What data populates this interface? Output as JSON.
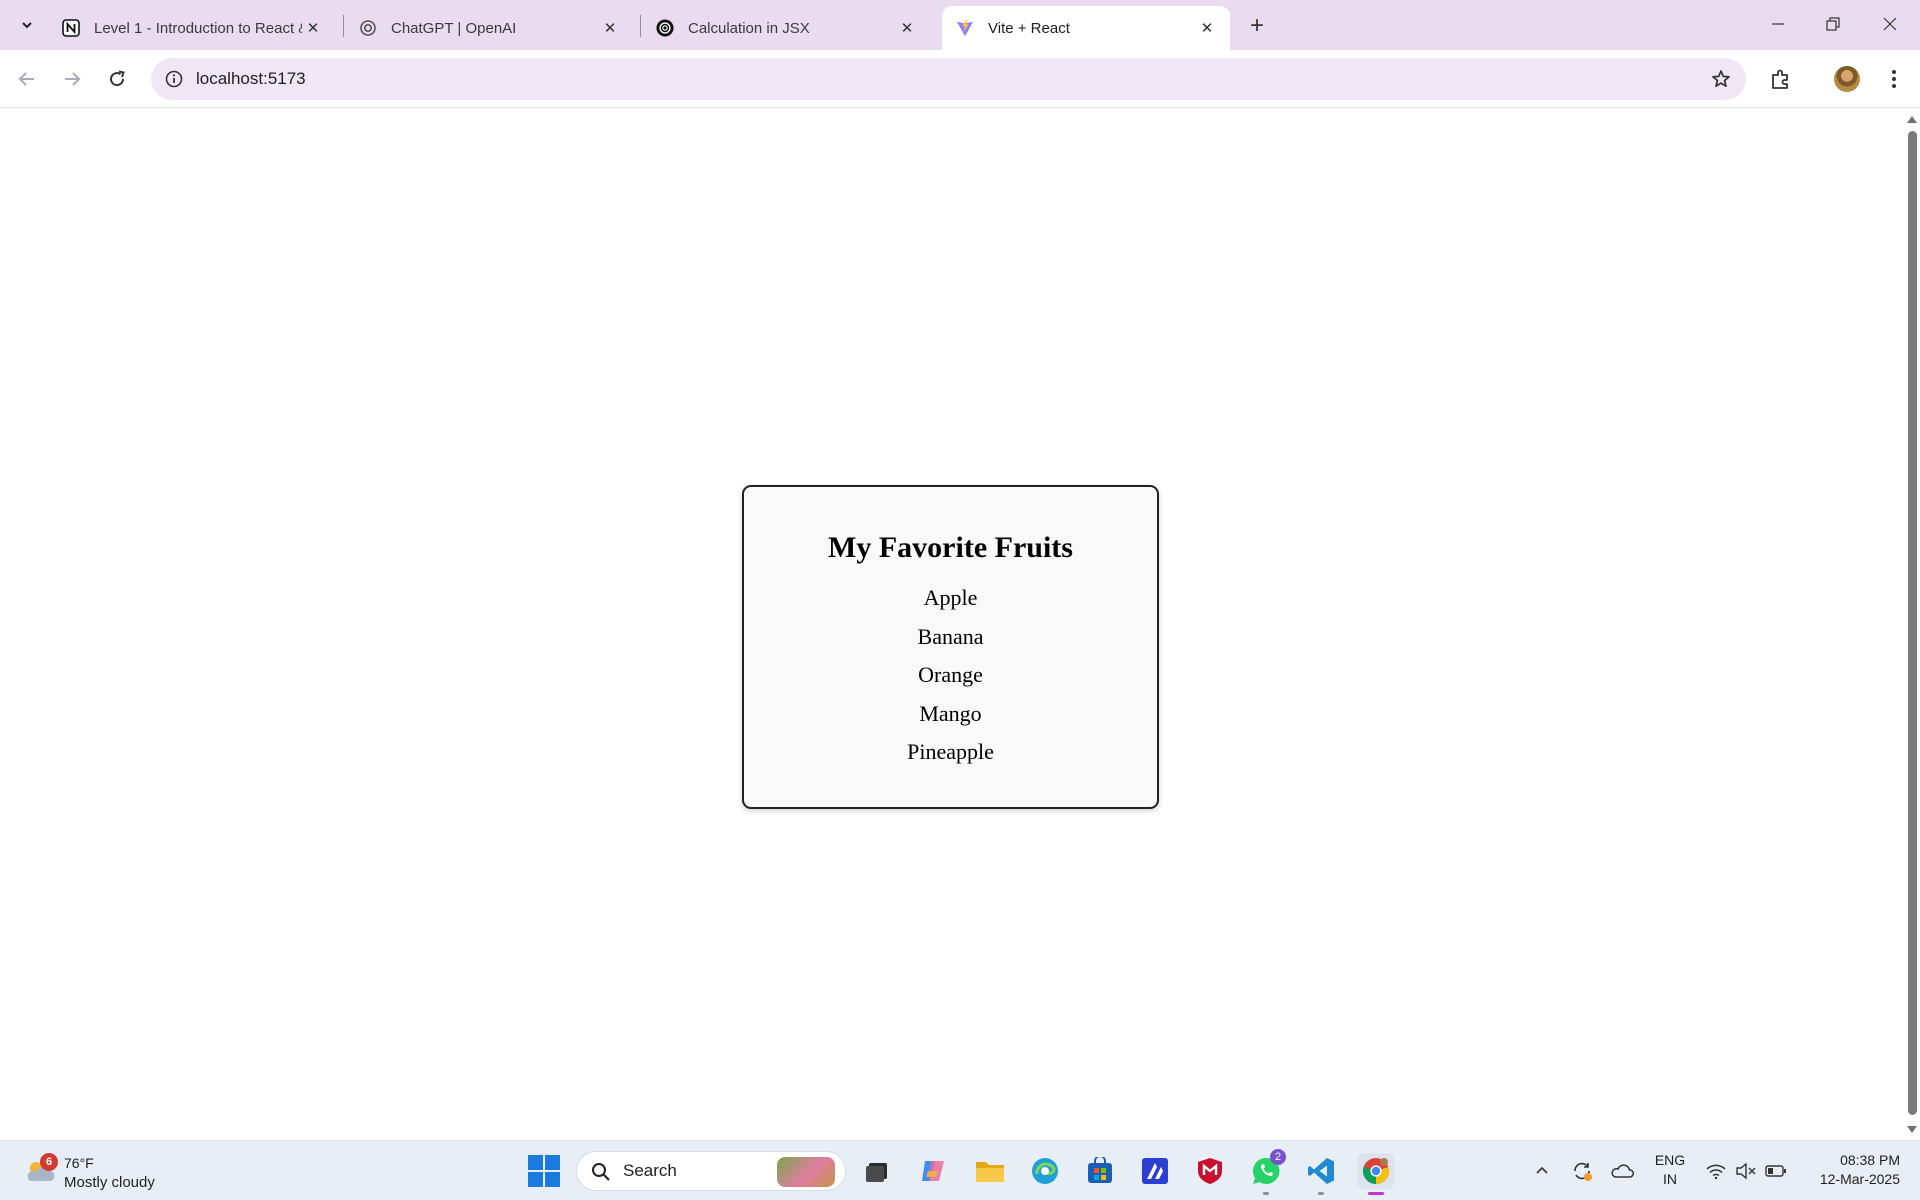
{
  "browser": {
    "tabs": [
      {
        "title": "Level 1 - Introduction to React &",
        "favicon": "notion-icon",
        "active": false
      },
      {
        "title": "ChatGPT | OpenAI",
        "favicon": "openai-icon",
        "active": false
      },
      {
        "title": "Calculation in JSX",
        "favicon": "openai-icon",
        "active": false
      },
      {
        "title": "Vite + React",
        "favicon": "vite-icon",
        "active": true
      }
    ],
    "address": "localhost:5173"
  },
  "page": {
    "heading": "My Favorite Fruits",
    "fruits": [
      "Apple",
      "Banana",
      "Orange",
      "Mango",
      "Pineapple"
    ]
  },
  "taskbar": {
    "weather": {
      "badge": "6",
      "temp": "76°F",
      "condition": "Mostly cloudy"
    },
    "search_label": "Search",
    "whatsapp_badge": "2",
    "language": {
      "line1": "ENG",
      "line2": "IN"
    },
    "clock": {
      "time": "08:38 PM",
      "date": "12-Mar-2025"
    }
  },
  "colors": {
    "tabstrip": "#e9dcf0",
    "omnibox": "#f0e6f5",
    "card_background": "#f9f9f9",
    "card_border": "#222222",
    "taskbar": "#e8eef6",
    "chrome_indicator": "#c13ad0"
  }
}
